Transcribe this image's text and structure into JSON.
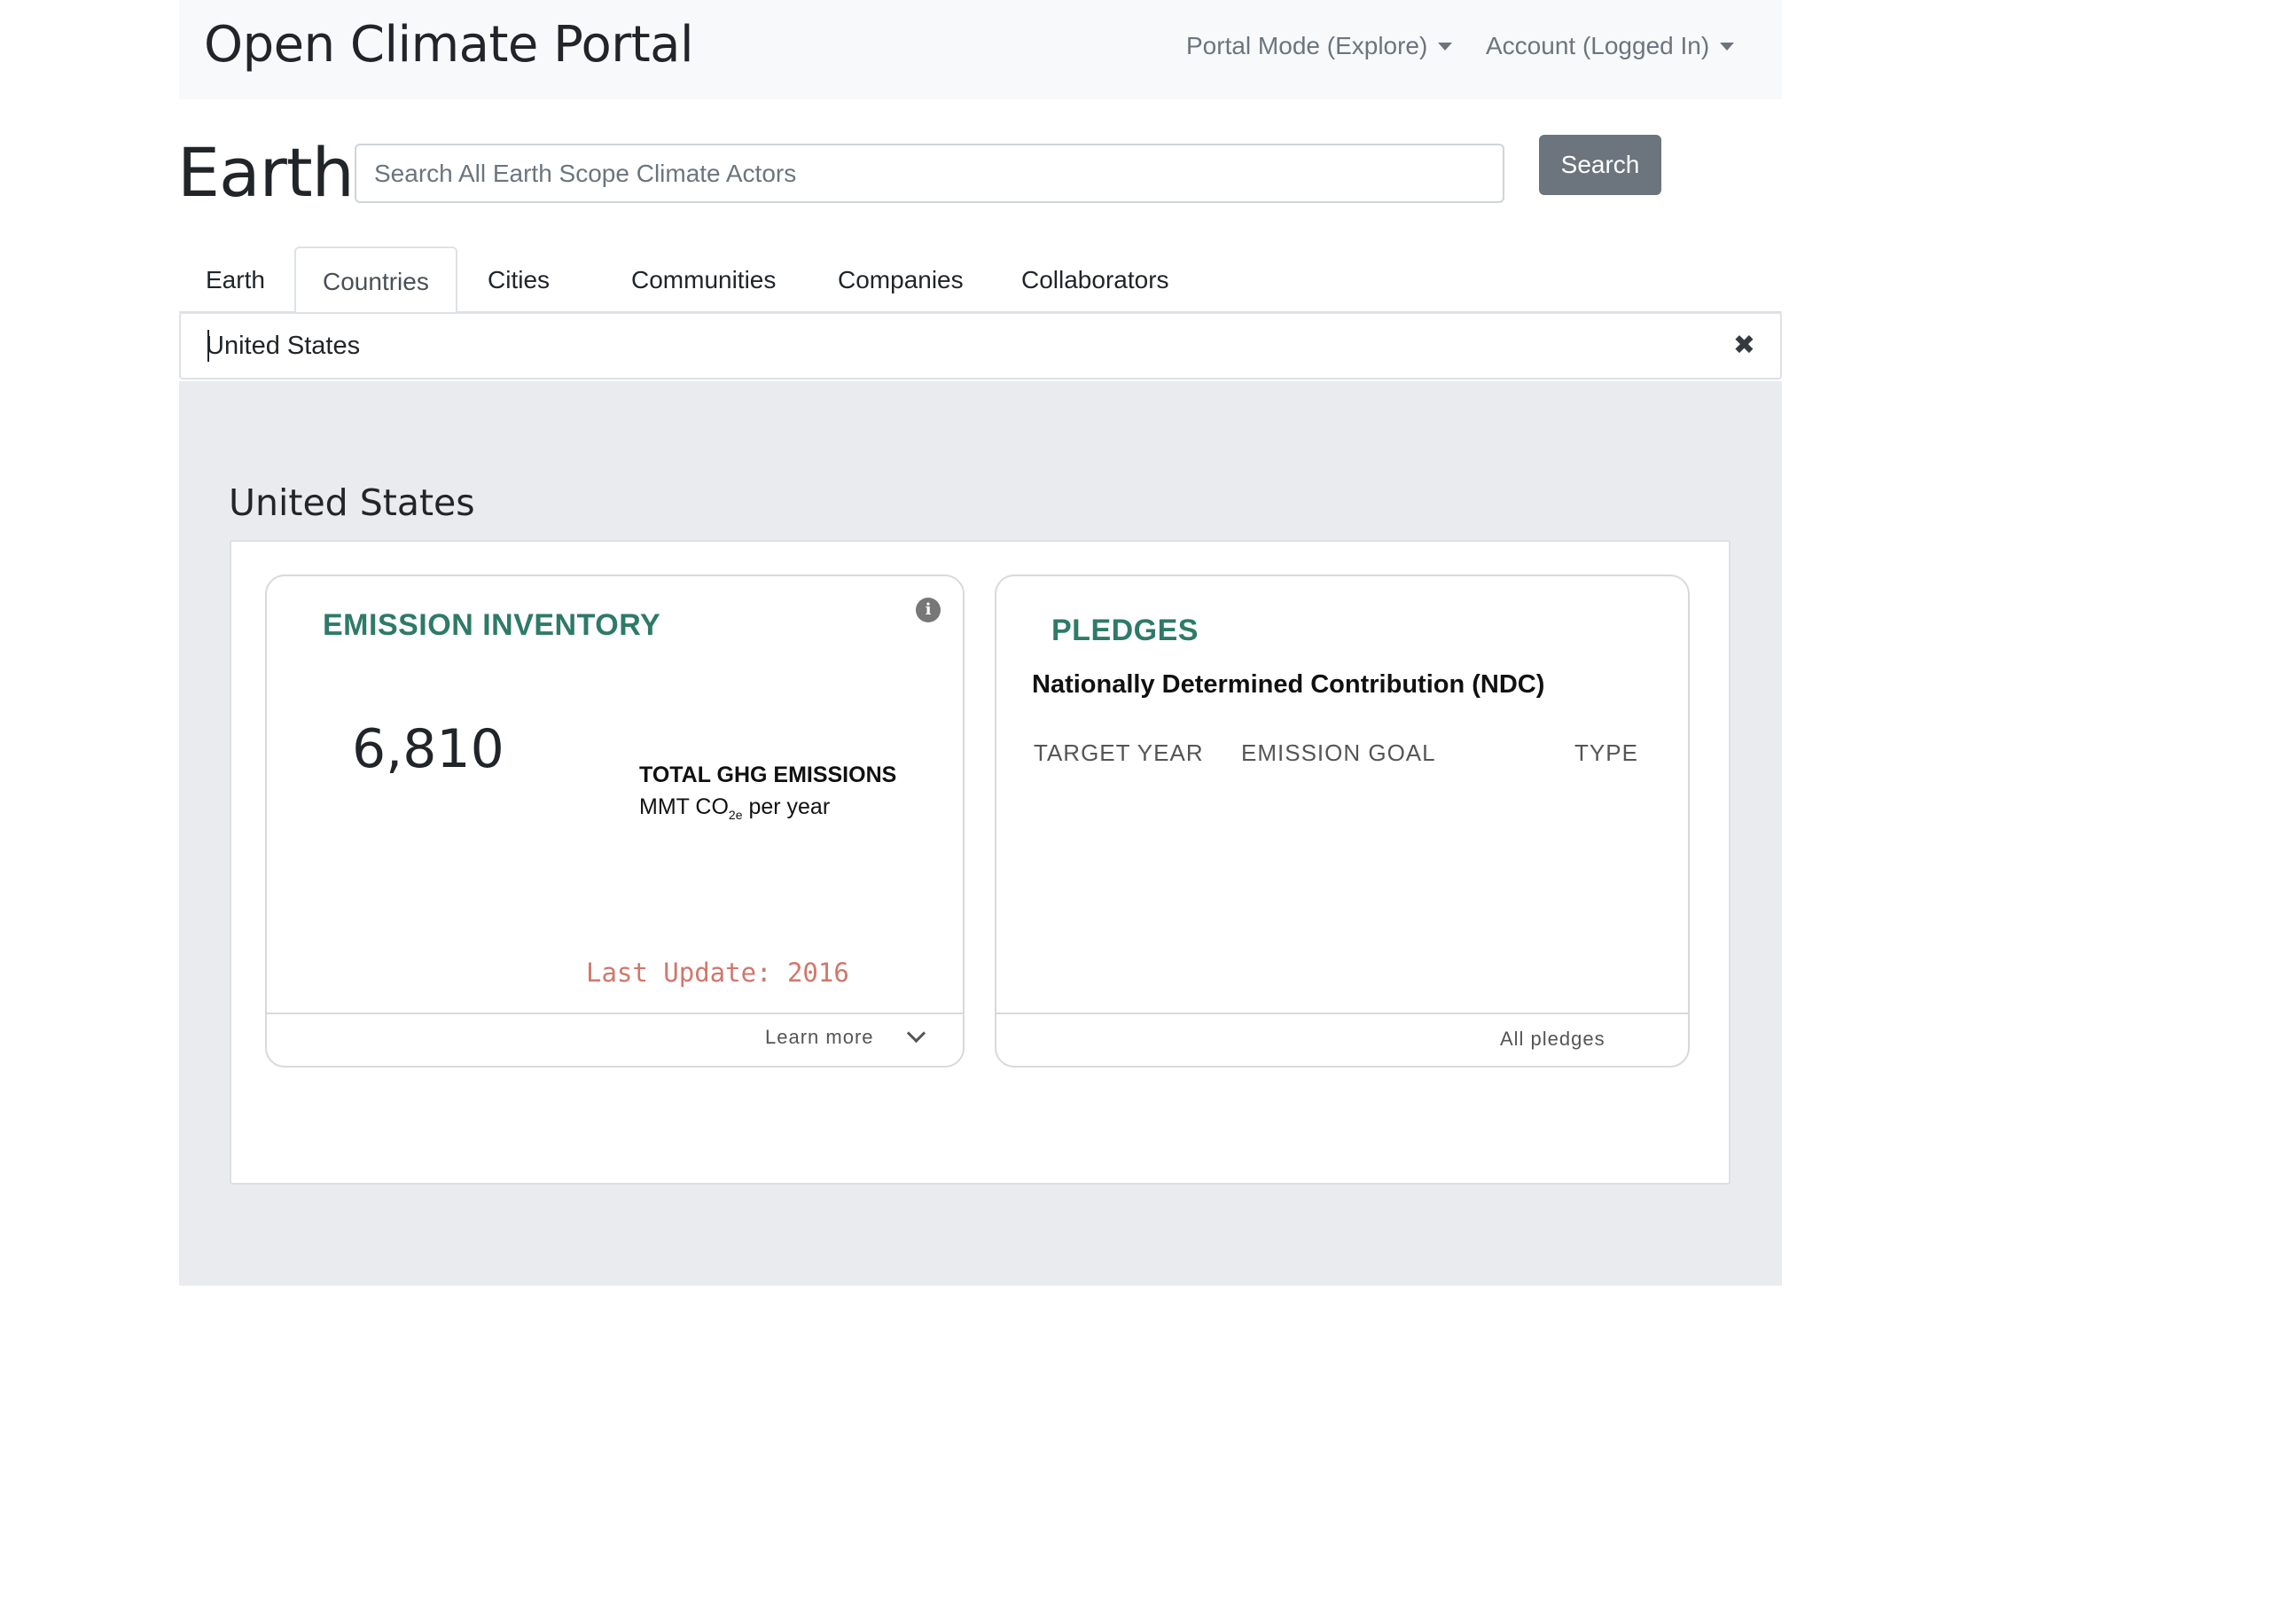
{
  "navbar": {
    "brand": "Open Climate Portal",
    "portal_mode": "Portal Mode (Explore)",
    "account": "Account (Logged In)"
  },
  "heading": "Earth",
  "search": {
    "placeholder": "Search All Earth Scope Climate Actors",
    "button_label": "Search"
  },
  "tabs": [
    {
      "label": "Earth",
      "active": false
    },
    {
      "label": "Countries",
      "active": true
    },
    {
      "label": "Cities",
      "active": false
    },
    {
      "label": "Communities",
      "active": false
    },
    {
      "label": "Companies",
      "active": false
    },
    {
      "label": "Collaborators",
      "active": false
    }
  ],
  "actor_field": {
    "value": "United States",
    "clear_icon": "close-icon"
  },
  "section_title": "United States",
  "emission_card": {
    "title": "EMISSION INVENTORY",
    "value": "6,810",
    "metric_label": "TOTAL GHG EMISSIONS",
    "unit_prefix": "MMT CO",
    "unit_sub": "2e",
    "unit_suffix": " per year",
    "last_update": "Last Update: 2016",
    "footer_link": "Learn more",
    "info_icon": "info-icon",
    "chevron_icon": "chevron-down-icon"
  },
  "pledges_card": {
    "title": "PLEDGES",
    "subtitle": "Nationally Determined Contribution (NDC)",
    "columns": [
      "TARGET YEAR",
      "EMISSION GOAL",
      "TYPE"
    ],
    "footer_link": "All pledges"
  },
  "colors": {
    "accent_green": "#2e7a68",
    "last_update": "#d0776b",
    "button_grey": "#6c757d",
    "panel_grey": "#e9ebee"
  }
}
